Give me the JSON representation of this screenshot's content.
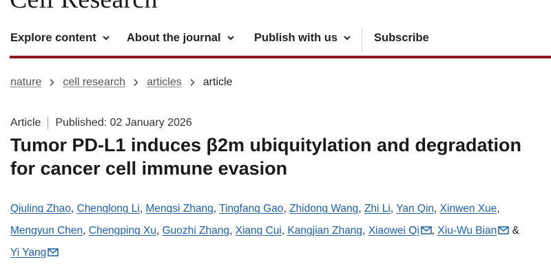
{
  "site": {
    "logo_text": "Cell Research"
  },
  "nav": {
    "items": [
      {
        "label": "Explore content",
        "has_dropdown": true
      },
      {
        "label": "About the journal",
        "has_dropdown": true
      },
      {
        "label": "Publish with us",
        "has_dropdown": true
      }
    ],
    "subscribe_label": "Subscribe"
  },
  "breadcrumb": {
    "items": [
      "nature",
      "cell research",
      "articles"
    ],
    "current": "article"
  },
  "article": {
    "type": "Article",
    "published": "Published: 02 January 2026",
    "title": "Tumor PD-L1 induces β2m ubiquitylation and degradation for cancer cell immune evasion",
    "authors": [
      {
        "name": "Qiuling Zhao"
      },
      {
        "name": "Chenglong Li"
      },
      {
        "name": "Mengsi Zhang"
      },
      {
        "name": "Tingfang Gao"
      },
      {
        "name": "Zhidong Wang"
      },
      {
        "name": "Zhi Li"
      },
      {
        "name": "Yan Qin"
      },
      {
        "name": "Xinwen Xue"
      },
      {
        "name": "Mengyun Chen"
      },
      {
        "name": "Chengping Xu"
      },
      {
        "name": "Guozhi Zhang"
      },
      {
        "name": "Xiang Cui"
      },
      {
        "name": "Kangjian Zhang"
      },
      {
        "name": "Xiaowei Qi",
        "corresponding": true
      },
      {
        "name": "Xiu-Wu Bian",
        "corresponding": true
      },
      {
        "name": "Yi Yang",
        "corresponding": true
      }
    ],
    "separator": ",",
    "final_conjunction": "&"
  },
  "colors": {
    "accent": "#8e1a1f",
    "link": "#1f5fa6",
    "text": "#222222"
  },
  "icons": {
    "nav_dropdown": "chevron-down-icon",
    "breadcrumb_sep": "chevron-right-icon",
    "email": "mail-icon"
  }
}
